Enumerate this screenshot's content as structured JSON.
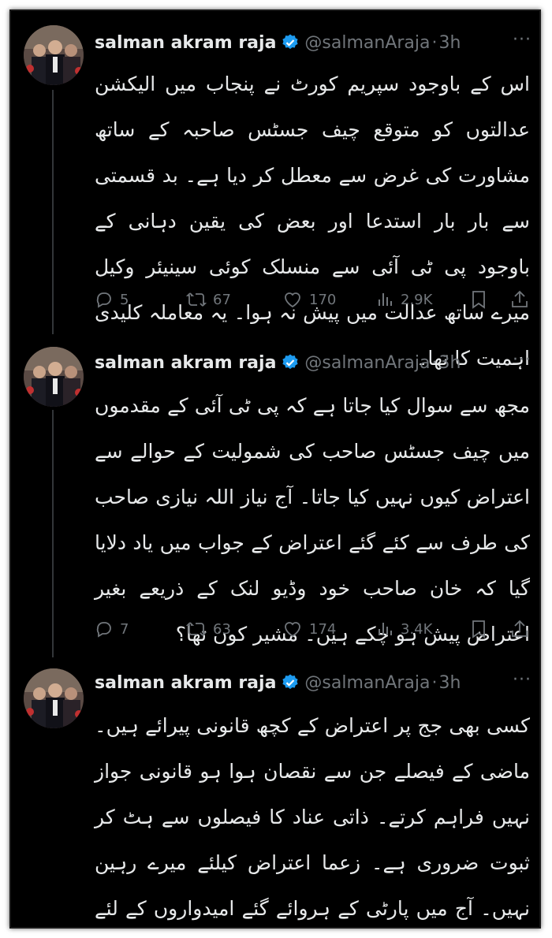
{
  "tweets": [
    {
      "name": "salman akram raja",
      "handle": "@salmanAraja",
      "dot": "·",
      "time": "3h",
      "more": "···",
      "text": "اس کے باوجود سپریم کورٹ نے پنجاب میں الیکشن عدالتوں کو متوقع چیف جسٹس صاحبہ کے ساتھ مشاورت کی غرض سے معطل کر دیا ہے۔ بد قسمتی سے بار بار استدعا اور بعض کی یقین دہانی کے باوجود پی ٹی آئی سے منسلک کوئی سینیئر وکیل میرے ساتھ عدالت میں پیش نہ ہوا۔ یہ معاملہ کلیدی اہمیت کا تھا۔",
      "replies": "5",
      "reposts": "67",
      "likes": "170",
      "views": "2.9K"
    },
    {
      "name": "salman akram raja",
      "handle": "@salmanAraja",
      "dot": "·",
      "time": "3h",
      "more": "···",
      "text": "مجھ سے سوال کیا جاتا ہے کہ پی ٹی آئی کے مقدموں میں چیف جسٹس صاحب کی شمولیت کے حوالے سے اعتراض کیوں نہیں کیا جاتا۔ آج نیاز اللہ نیازی صاحب کی طرف سے کئے گئے اعتراض کے جواب میں یاد دلایا گیا کہ خان صاحب خود وڈیو لنک کے ذریعے بغیر اعتراض پیش ہو چکے ہیں۔ مشیر کون تھا؟",
      "replies": "7",
      "reposts": "63",
      "likes": "174",
      "views": "3.4K"
    },
    {
      "name": "salman akram raja",
      "handle": "@salmanAraja",
      "dot": "·",
      "time": "3h",
      "more": "···",
      "text": "کسی بھی جج پر اعتراض کے کچھ قانونی پیرائے ہیں۔ ماضی کے فیصلے جن سے نقصان ہوا ہو قانونی جواز نہیں فراہم کرتے۔ ذاتی عناد کا فیصلوں سے ہٹ کر ثبوت ضروری ہے۔ زعما اعتراض کیلئے میرے رہین نہیں۔ آج میں پارٹی کے ہروائے گئے امیدواروں کے لئے پیش ہوا۔ تنہا۔ تاریکی میں شمع جلائیے۔"
    }
  ],
  "colors": {
    "background": "#000000",
    "text": "#e7e9ea",
    "muted": "#71767b",
    "verified": "#1d9bf0"
  }
}
